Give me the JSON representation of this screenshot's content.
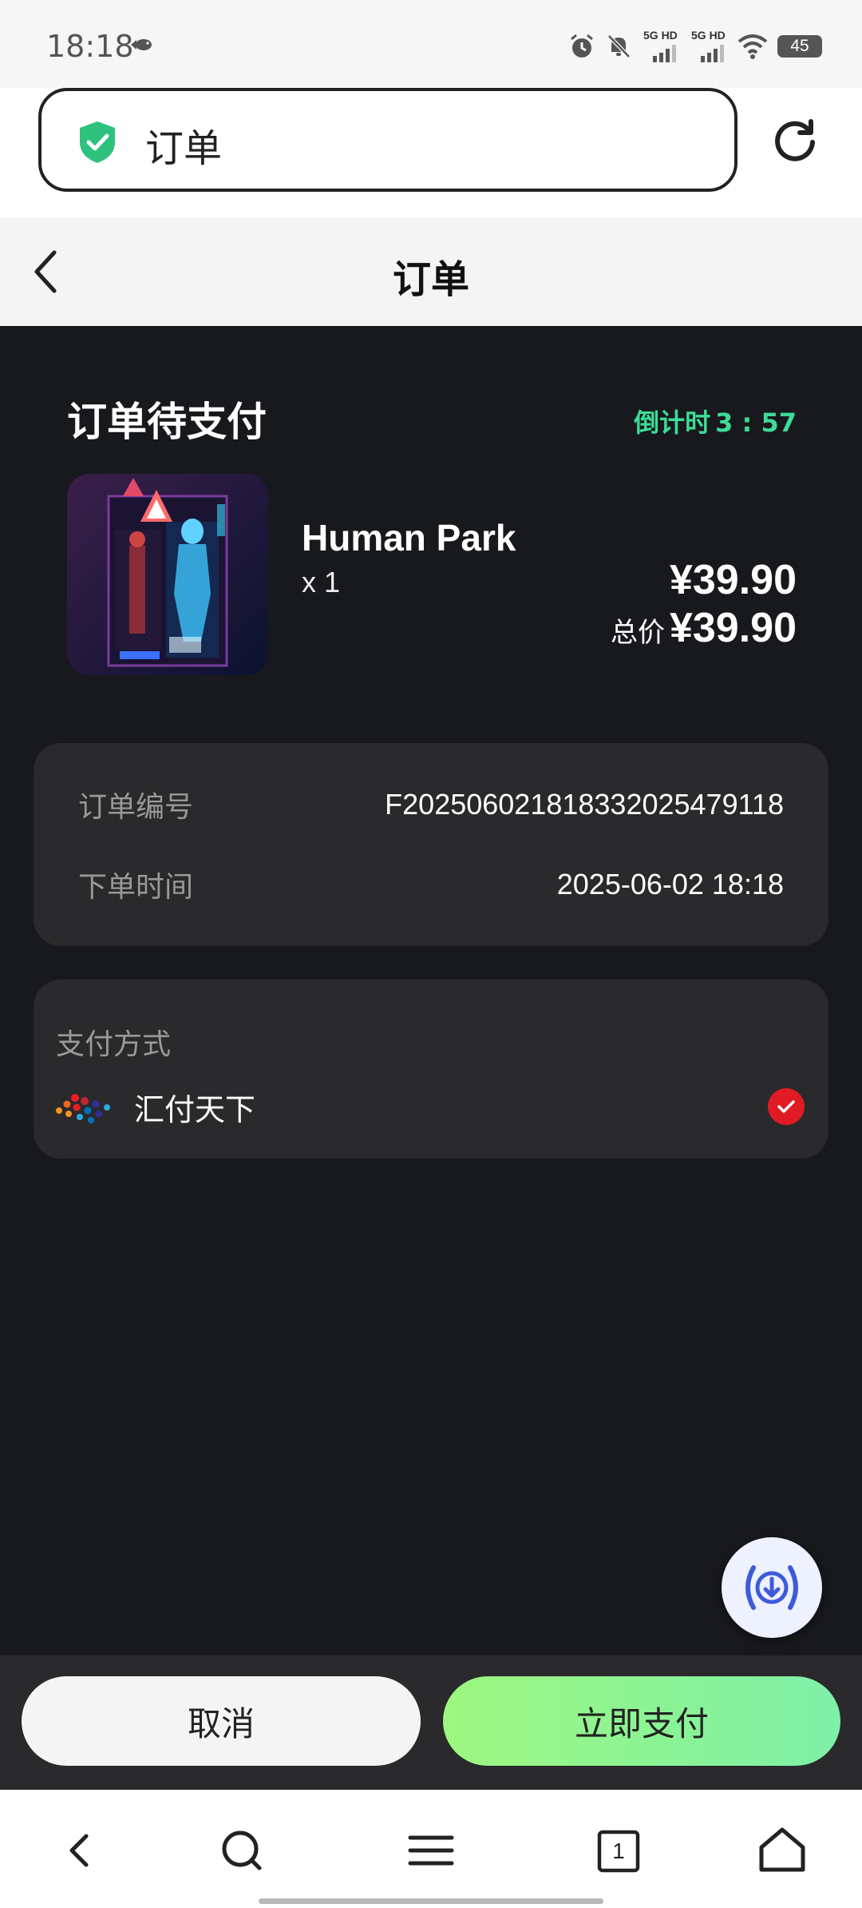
{
  "status_bar": {
    "time": "18:18",
    "signal1_label": "5G HD",
    "signal2_label": "5G HD",
    "battery": "45"
  },
  "browser": {
    "url_text": "订单"
  },
  "header": {
    "title": "订单"
  },
  "order": {
    "status_title": "订单待支付",
    "countdown_label": "倒计时",
    "countdown_value": "3 : 57",
    "product_name": "Human Park",
    "quantity": "x 1",
    "price": "¥39.90",
    "total_label": "总价",
    "total_value": "¥39.90"
  },
  "info": {
    "order_no_label": "订单编号",
    "order_no_value": "F20250602181833202547​9118",
    "time_label": "下单时间",
    "time_value": "2025-06-02 18:18"
  },
  "payment": {
    "title": "支付方式",
    "method_name": "汇付天下"
  },
  "actions": {
    "cancel_label": "取消",
    "pay_label": "立即支付"
  },
  "bottom_nav": {
    "tabs_count": "1"
  },
  "colors": {
    "accent_green": "#3ddc97",
    "pay_gradient_start": "#9cf77f",
    "pay_gradient_end": "#7ef0a8",
    "check_red": "#e11b24",
    "dark_bg": "#18191d",
    "card_bg": "#2a2a2c"
  }
}
